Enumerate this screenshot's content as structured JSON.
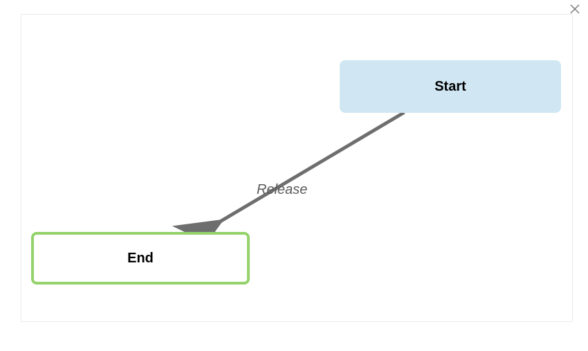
{
  "nodes": {
    "start": {
      "label": "Start"
    },
    "end": {
      "label": "End"
    }
  },
  "edges": {
    "release": {
      "label": "Release"
    }
  },
  "colors": {
    "start_bg": "#d0e7f3",
    "end_border": "#94d26b",
    "arrow": "#6e6e6e"
  }
}
